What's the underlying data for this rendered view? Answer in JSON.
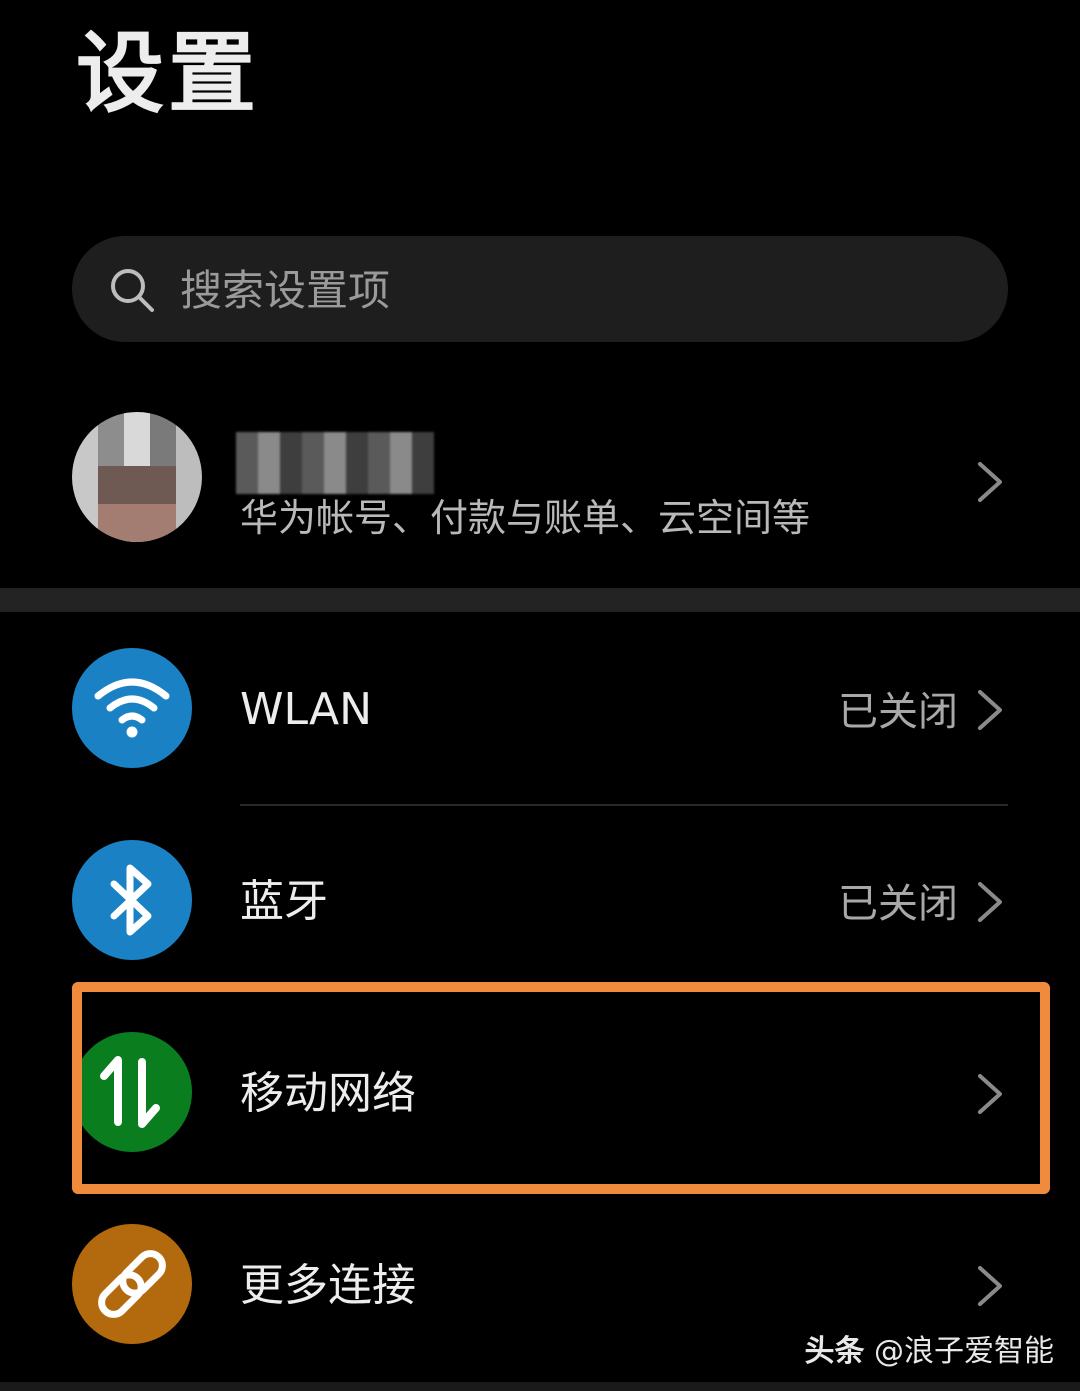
{
  "header": {
    "title": "设置"
  },
  "search": {
    "placeholder": "搜索设置项"
  },
  "account": {
    "subtitle": "华为帐号、付款与账单、云空间等"
  },
  "rows": [
    {
      "label": "WLAN",
      "status": "已关闭",
      "icon": "wifi-icon",
      "color": "#1a82c4"
    },
    {
      "label": "蓝牙",
      "status": "已关闭",
      "icon": "bluetooth-icon",
      "color": "#1a82c4"
    },
    {
      "label": "移动网络",
      "status": "",
      "icon": "mobile-data-icon",
      "color": "#0a7d1f"
    },
    {
      "label": "更多连接",
      "status": "",
      "icon": "link-icon",
      "color": "#b36a0f"
    }
  ],
  "highlight_color": "#f08a3c",
  "watermark": {
    "brand": "头条",
    "handle": "@浪子爱智能"
  }
}
